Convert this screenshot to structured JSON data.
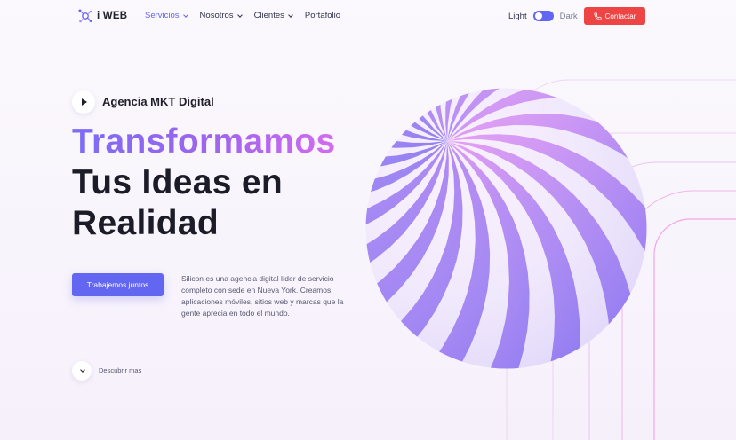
{
  "brand": {
    "name": "i WEB"
  },
  "nav": {
    "items": [
      {
        "label": "Servicios",
        "has_dropdown": true,
        "active": true
      },
      {
        "label": "Nosotros",
        "has_dropdown": true,
        "active": false
      },
      {
        "label": "Clientes",
        "has_dropdown": true,
        "active": false
      },
      {
        "label": "Portafolio",
        "has_dropdown": false,
        "active": false
      }
    ]
  },
  "theme_switch": {
    "light_label": "Light",
    "dark_label": "Dark"
  },
  "contact_button": {
    "label": "Contactar",
    "icon": "phone-icon"
  },
  "hero": {
    "eyebrow": "Agencia MKT Digital",
    "title_line1": "Transformamos",
    "title_line2": "Tus Ideas en",
    "title_line3": "Realidad",
    "cta_label": "Trabajemos juntos",
    "description": "Silicon es una agencia digital líder de servicio completo con sede en Nueva York. Creamos aplicaciones móviles, sitios web y marcas que la gente aprecia en todo el mundo.",
    "discover_label": "Descubrir mas"
  },
  "colors": {
    "primary": "#6366f1",
    "danger": "#ef4444",
    "gradient_start": "#7b6cf6",
    "gradient_end": "#d46bf0"
  }
}
